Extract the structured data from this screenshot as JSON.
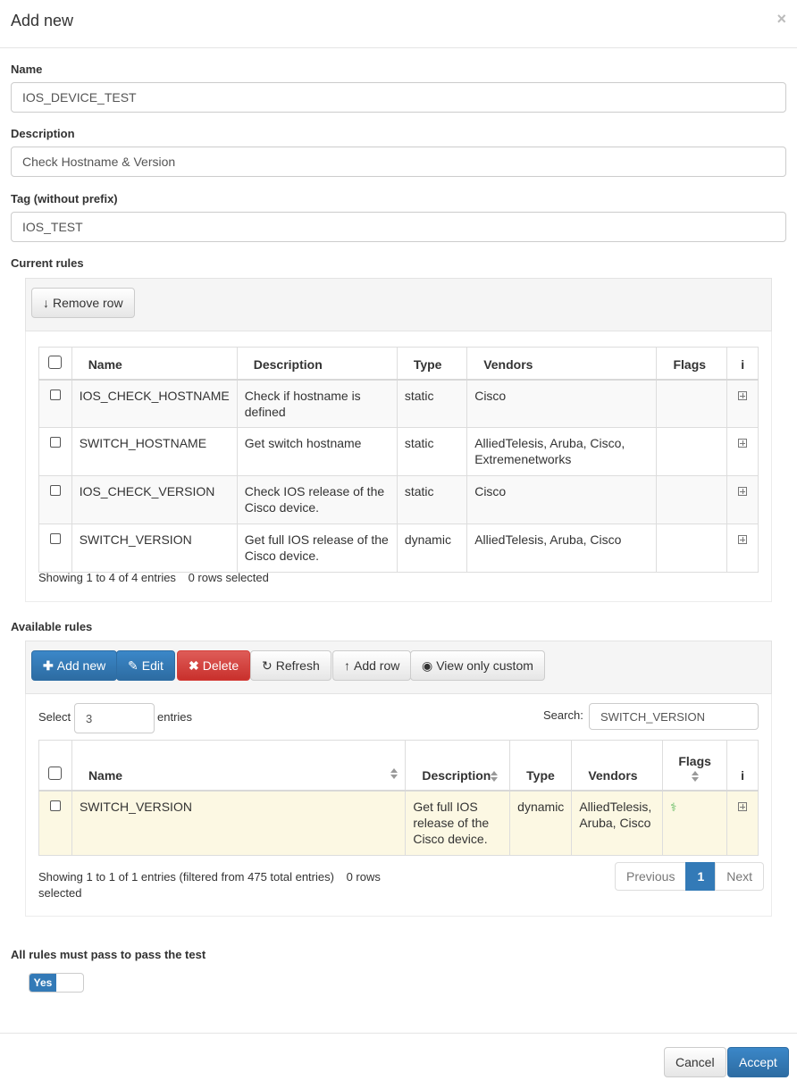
{
  "modal": {
    "title": "Add new",
    "close": "×"
  },
  "form": {
    "name_label": "Name",
    "name_value": "IOS_DEVICE_TEST",
    "description_label": "Description",
    "description_value": "Check Hostname & Version",
    "tag_label": "Tag (without prefix)",
    "tag_value": "IOS_TEST"
  },
  "current_rules": {
    "label": "Current rules",
    "remove_row": "Remove row",
    "columns": [
      "Name",
      "Description",
      "Type",
      "Vendors",
      "Flags",
      "i"
    ],
    "rows": [
      {
        "name": "IOS_CHECK_HOSTNAME",
        "description": "Check if hostname is defined",
        "type": "static",
        "vendors": "Cisco"
      },
      {
        "name": "SWITCH_HOSTNAME",
        "description": "Get switch hostname",
        "type": "static",
        "vendors": "AlliedTelesis, Aruba, Cisco, Extremenetworks"
      },
      {
        "name": "IOS_CHECK_VERSION",
        "description": "Check IOS release of the Cisco device.",
        "type": "static",
        "vendors": "Cisco"
      },
      {
        "name": "SWITCH_VERSION",
        "description": "Get full IOS release of the Cisco device.",
        "type": "dynamic",
        "vendors": "AlliedTelesis, Aruba, Cisco"
      }
    ],
    "info": "Showing 1 to 4 of 4 entries",
    "selected": "0 rows selected"
  },
  "available_rules": {
    "label": "Available rules",
    "add_new": "Add new",
    "edit": "Edit",
    "delete": "Delete",
    "refresh": "Refresh",
    "add_row": "Add row",
    "view_only_custom": "View only custom",
    "select_label": "Select",
    "select_value": "3",
    "entries_label": "entries",
    "search_label": "Search:",
    "search_value": "SWITCH_VERSION",
    "columns": [
      "Name",
      "Description",
      "Type",
      "Vendors",
      "Flags",
      "i"
    ],
    "rows": [
      {
        "name": "SWITCH_VERSION",
        "description": "Get full IOS release of the Cisco device.",
        "type": "dynamic",
        "vendors": "AlliedTelesis, Aruba, Cisco"
      }
    ],
    "info": "Showing 1 to 1 of 1 entries (filtered from 475 total entries)",
    "selected": "0 rows selected",
    "pager": {
      "previous": "Previous",
      "page": "1",
      "next": "Next"
    }
  },
  "pass_all": {
    "label": "All rules must pass to pass the test",
    "toggle": "Yes"
  },
  "footer": {
    "cancel": "Cancel",
    "accept": "Accept"
  },
  "colors": {
    "primary": "#337ab7",
    "danger": "#d9534f",
    "highlight": "#fcf8e3",
    "flag_icon": "#5cb85c"
  }
}
